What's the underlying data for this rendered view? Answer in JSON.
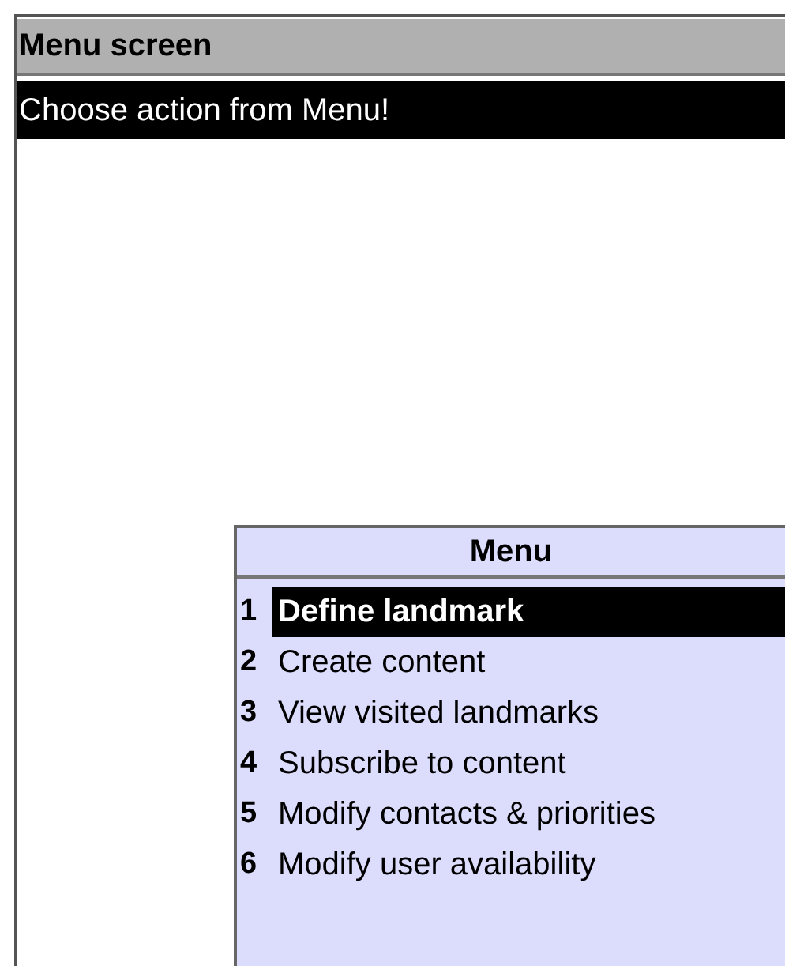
{
  "window": {
    "title": "Menu screen"
  },
  "message": "Choose action from Menu!",
  "menu": {
    "title": "Menu",
    "items": [
      {
        "number": "1",
        "label": "Define landmark",
        "selected": true
      },
      {
        "number": "2",
        "label": "Create content",
        "selected": false
      },
      {
        "number": "3",
        "label": "View visited landmarks",
        "selected": false
      },
      {
        "number": "4",
        "label": "Subscribe to content",
        "selected": false
      },
      {
        "number": "5",
        "label": "Modify contacts & priorities",
        "selected": false
      },
      {
        "number": "6",
        "label": "Modify user availability",
        "selected": false
      }
    ]
  }
}
